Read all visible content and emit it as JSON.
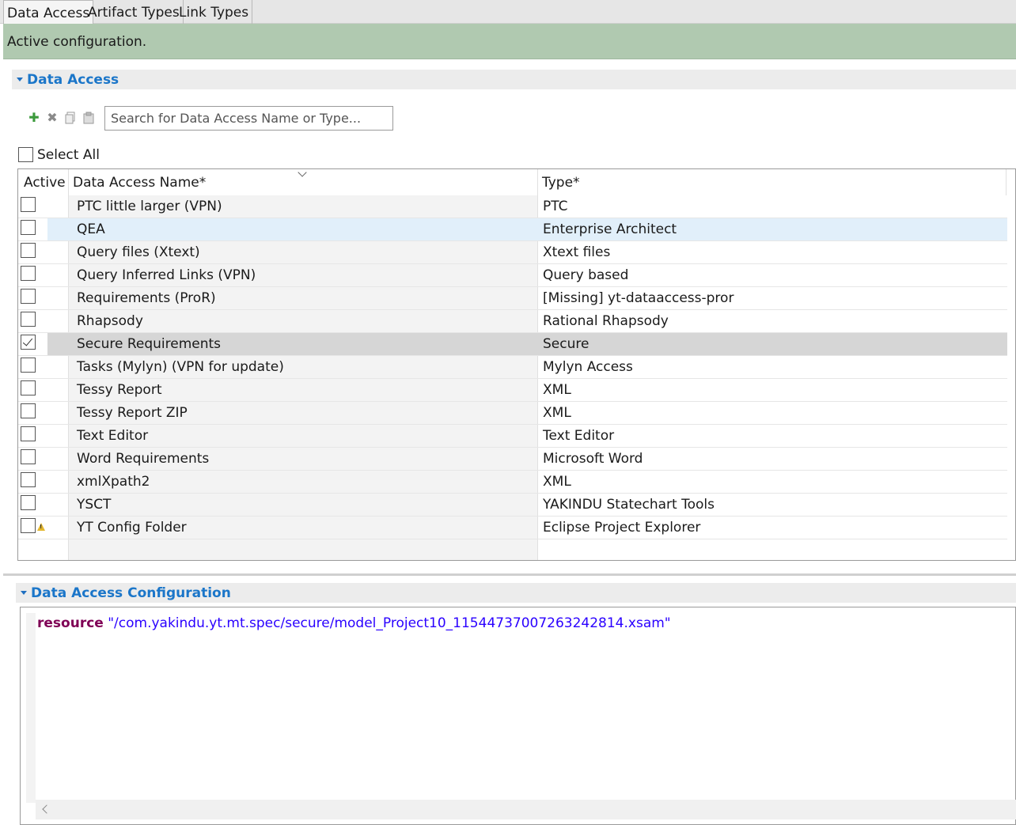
{
  "tabs": [
    {
      "label": "Data Access",
      "active": true
    },
    {
      "label": "Artifact Types",
      "active": false
    },
    {
      "label": "Link Types",
      "active": false
    }
  ],
  "banner": {
    "text": "Active configuration.",
    "color": "#b0c9b0"
  },
  "data_access_section": {
    "title": "Data Access",
    "toolbar": {
      "icons": [
        "add-icon",
        "delete-icon",
        "copy-icon",
        "paste-icon"
      ],
      "search_placeholder": "Search for Data Access Name or Type..."
    },
    "select_all_label": "Select All",
    "table": {
      "columns": [
        "Active",
        "Data Access Name*",
        "Type*"
      ],
      "rows": [
        {
          "active": false,
          "name": "PTC little larger (VPN)",
          "type": "PTC"
        },
        {
          "active": false,
          "name": "QEA",
          "type": "Enterprise Architect"
        },
        {
          "active": false,
          "name": "Query files (Xtext)",
          "type": "Xtext files"
        },
        {
          "active": false,
          "name": "Query Inferred Links (VPN)",
          "type": "Query based"
        },
        {
          "active": false,
          "name": "Requirements (ProR)",
          "type": "[Missing] yt-dataaccess-pror"
        },
        {
          "active": false,
          "name": "Rhapsody",
          "type": "Rational Rhapsody"
        },
        {
          "active": true,
          "name": "Secure Requirements",
          "type": "Secure"
        },
        {
          "active": false,
          "name": "Tasks (Mylyn) (VPN for update)",
          "type": "Mylyn Access"
        },
        {
          "active": false,
          "name": "Tessy Report",
          "type": "XML"
        },
        {
          "active": false,
          "name": "Tessy Report ZIP",
          "type": "XML"
        },
        {
          "active": false,
          "name": "Text Editor",
          "type": "Text Editor"
        },
        {
          "active": false,
          "name": "Word Requirements",
          "type": "Microsoft Word"
        },
        {
          "active": false,
          "name": "xmlXpath2",
          "type": "XML"
        },
        {
          "active": false,
          "name": "YSCT",
          "type": "YAKINDU Statechart Tools"
        },
        {
          "active": false,
          "name": "YT Config Folder",
          "type": "Eclipse Project Explorer",
          "warning": true
        }
      ]
    }
  },
  "config_section": {
    "title": "Data Access Configuration",
    "keyword": "resource",
    "value": "\"/com.yakindu.yt.mt.spec/secure/model_Project10_11544737007263242814.xsam\""
  }
}
